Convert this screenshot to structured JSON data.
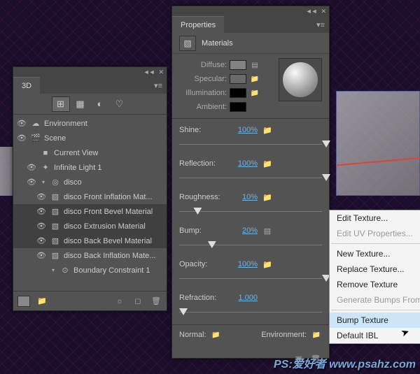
{
  "panels": {
    "threeD": {
      "tab_label": "3D",
      "tree": {
        "environment": "Environment",
        "scene": "Scene",
        "current_view": "Current View",
        "infinite_light": "Infinite Light 1",
        "disco": "disco",
        "materials": [
          "disco Front Inflation Mat...",
          "disco Front Bevel Material",
          "disco Extrusion Material",
          "disco Back Bevel Material",
          "disco Back Inflation Mate..."
        ],
        "boundary": "Boundary Constraint 1"
      }
    },
    "properties": {
      "tab_label": "Properties",
      "section_title": "Materials",
      "swatches": {
        "diffuse": {
          "label": "Diffuse:",
          "color": "#838383"
        },
        "specular": {
          "label": "Specular:",
          "color": "#6a6a6a"
        },
        "illumination": {
          "label": "Illumination:",
          "color": "#000000"
        },
        "ambient": {
          "label": "Ambient:",
          "color": "#000000"
        }
      },
      "sliders": {
        "shine": {
          "label": "Shine:",
          "value": "100%",
          "pos": 100
        },
        "reflection": {
          "label": "Reflection:",
          "value": "100%",
          "pos": 100
        },
        "roughness": {
          "label": "Roughness:",
          "value": "10%",
          "pos": 10
        },
        "bump": {
          "label": "Bump:",
          "value": "20%",
          "pos": 20
        },
        "opacity": {
          "label": "Opacity:",
          "value": "100%",
          "pos": 100
        },
        "refraction": {
          "label": "Refraction:",
          "value": "1.000",
          "pos": 0
        }
      },
      "bottom": {
        "normal": "Normal:",
        "environment": "Environment:"
      }
    }
  },
  "context_menu": {
    "edit_texture": "Edit Texture...",
    "edit_uv": "Edit UV Properties...",
    "new_texture": "New Texture...",
    "replace_texture": "Replace Texture...",
    "remove_texture": "Remove Texture",
    "generate_bumps": "Generate Bumps From D",
    "bump_texture": "Bump Texture",
    "default_ibl": "Default IBL"
  },
  "watermark": "PS:爱好者 www.psahz.com"
}
